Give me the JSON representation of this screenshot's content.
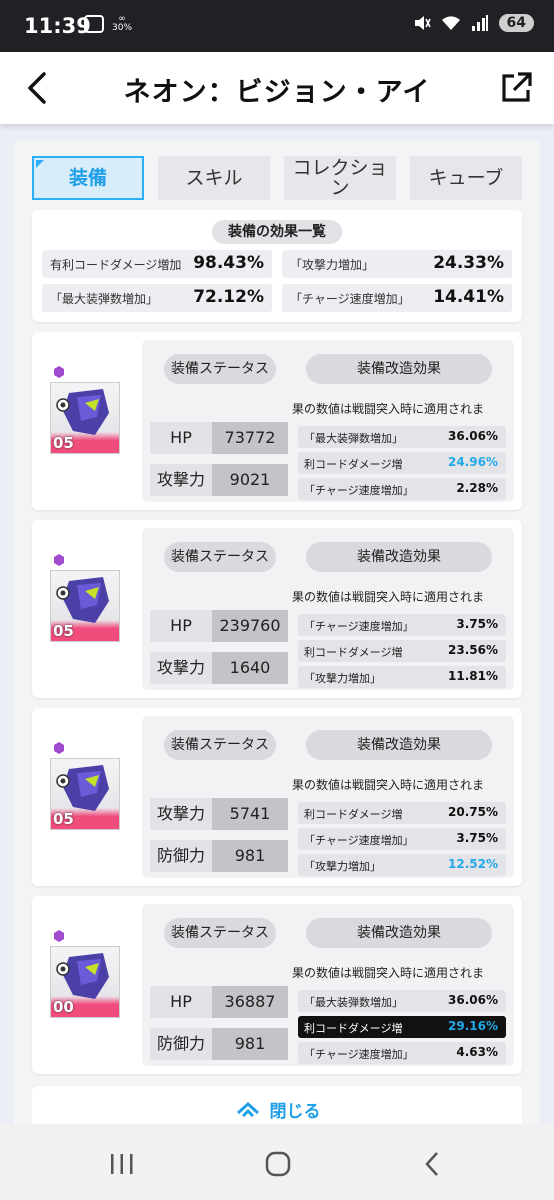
{
  "status_bar": {
    "time": "11:39",
    "data_speed": "30%",
    "battery": "64",
    "icons": [
      "screenshot-icon",
      "link-icon",
      "mute-icon",
      "wifi-icon",
      "signal-icon",
      "battery-icon"
    ]
  },
  "header": {
    "title": "ネオン：ビジョン・アイ",
    "back_icon": "back-arrow-icon",
    "share_icon": "external-link-icon"
  },
  "tabs": [
    {
      "label": "装備",
      "active": true
    },
    {
      "label": "スキル",
      "active": false
    },
    {
      "label": "コレクション",
      "active": false
    },
    {
      "label": "キューブ",
      "active": false
    }
  ],
  "summary": {
    "title": "装備の効果一覧",
    "items": [
      {
        "label": "有利コードダメージ増加",
        "value": "98.43%"
      },
      {
        "label": "「攻撃力増加」",
        "value": "24.33%"
      },
      {
        "label": "「最大装弾数増加」",
        "value": "72.12%"
      },
      {
        "label": "「チャージ速度増加」",
        "value": "14.41%"
      }
    ]
  },
  "common": {
    "status_label": "装備ステータス",
    "mod_label": "装備改造効果",
    "note": "果の数値は戦闘突入時に適用されま"
  },
  "equipment": [
    {
      "level": "05",
      "stats": [
        {
          "label": "HP",
          "value": "73772"
        },
        {
          "label": "攻撃力",
          "value": "9021"
        }
      ],
      "effects": [
        {
          "label": "「最大装弾数増加」",
          "value": "36.06%",
          "highlight": false,
          "dark": false
        },
        {
          "label": "利コードダメージ増",
          "value": "24.96%",
          "highlight": true,
          "dark": false
        },
        {
          "label": "「チャージ速度増加」",
          "value": "2.28%",
          "highlight": false,
          "dark": false
        }
      ]
    },
    {
      "level": "05",
      "stats": [
        {
          "label": "HP",
          "value": "239760"
        },
        {
          "label": "攻撃力",
          "value": "1640"
        }
      ],
      "effects": [
        {
          "label": "「チャージ速度増加」",
          "value": "3.75%",
          "highlight": false,
          "dark": false
        },
        {
          "label": "利コードダメージ増",
          "value": "23.56%",
          "highlight": false,
          "dark": false
        },
        {
          "label": "「攻撃力増加」",
          "value": "11.81%",
          "highlight": false,
          "dark": false
        }
      ]
    },
    {
      "level": "05",
      "stats": [
        {
          "label": "攻撃力",
          "value": "5741"
        },
        {
          "label": "防御力",
          "value": "981"
        }
      ],
      "effects": [
        {
          "label": "利コードダメージ増",
          "value": "20.75%",
          "highlight": false,
          "dark": false
        },
        {
          "label": "「チャージ速度増加」",
          "value": "3.75%",
          "highlight": false,
          "dark": false
        },
        {
          "label": "「攻撃力増加」",
          "value": "12.52%",
          "highlight": true,
          "dark": false
        }
      ]
    },
    {
      "level": "00",
      "stats": [
        {
          "label": "HP",
          "value": "36887"
        },
        {
          "label": "防御力",
          "value": "981"
        }
      ],
      "effects": [
        {
          "label": "「最大装弾数増加」",
          "value": "36.06%",
          "highlight": false,
          "dark": false
        },
        {
          "label": "利コードダメージ増",
          "value": "29.16%",
          "highlight": true,
          "dark": true
        },
        {
          "label": "「チャージ速度増加」",
          "value": "4.63%",
          "highlight": false,
          "dark": false
        }
      ]
    }
  ],
  "close": {
    "label": "閉じる",
    "icon": "chevron-up-icon"
  },
  "navbar": {
    "icons": [
      "recent-apps-icon",
      "home-icon",
      "back-icon"
    ]
  },
  "colors": {
    "accent": "#1f9fe8",
    "highlight_value": "#22a8e8",
    "rarity": "#a04ad0",
    "pink": "#f04c7c"
  }
}
